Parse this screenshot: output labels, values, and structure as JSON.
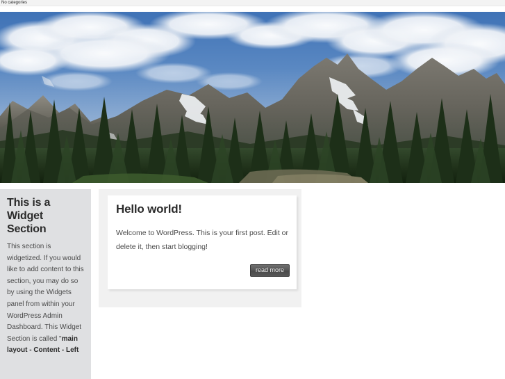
{
  "topbar": {
    "categories_label": "No categories"
  },
  "header": {
    "image_alt": "mountain-landscape-with-pine-forest-header-photo",
    "sky_color": "#4e7cb8",
    "cloud_color": "#f2f4f7",
    "mountain_color": "#6d6b63",
    "forest_color": "#23361f"
  },
  "sidebar": {
    "title": "This is a Widget Section",
    "body_before": "This section is widgetized. If you would like to add content to this section, you may do so by using the Widgets panel from within your WordPress Admin Dashboard. This Widget Section is called \"",
    "body_bold": "main layout - Content - Left",
    "background_color": "#dfe0e2"
  },
  "main": {
    "post": {
      "title": "Hello world!",
      "excerpt": "Welcome to WordPress. This is your first post. Edit or delete it, then start blogging!",
      "read_more_label": "read more"
    },
    "wrapper_color": "#f1f1f1",
    "card_color": "#ffffff"
  }
}
